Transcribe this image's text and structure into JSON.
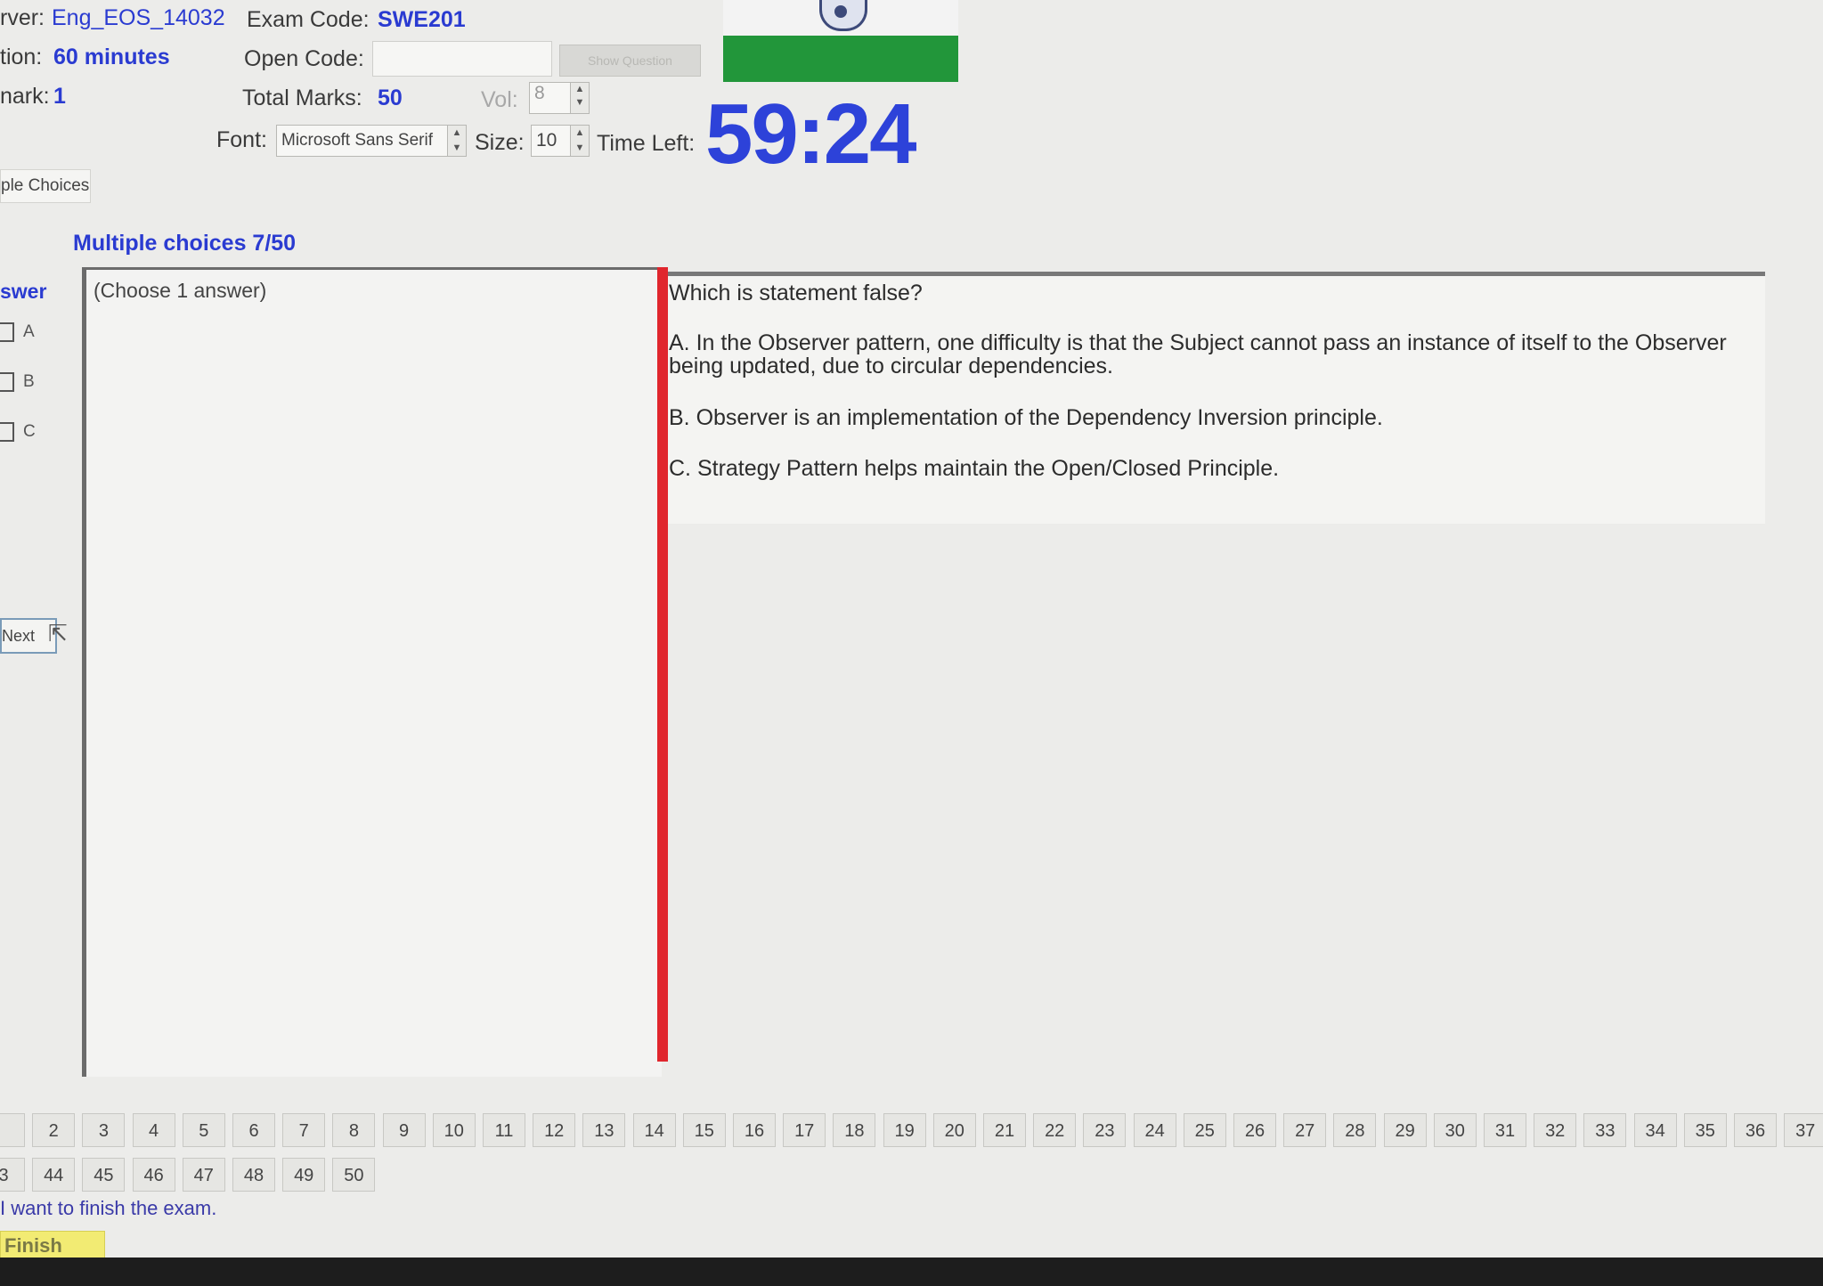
{
  "header": {
    "server_label": "rver:",
    "server_value": "Eng_EOS_14032",
    "exam_code_label": "Exam Code:",
    "exam_code_value": "SWE201",
    "duration_label": "tion:",
    "duration_value": "60 minutes",
    "open_code_label": "Open Code:",
    "open_code_value": "",
    "show_question_label": "Show Question",
    "mark_label": "nark:",
    "mark_value": "1",
    "total_marks_label": "Total Marks:",
    "total_marks_value": "50",
    "vol_label": "Vol:",
    "vol_value": "8",
    "font_label": "Font:",
    "font_value": "Microsoft Sans Serif",
    "size_label": "Size:",
    "size_value": "10",
    "time_left_label": "Time Left:",
    "time_left_value": "59:24"
  },
  "tab": {
    "label": "ple Choices"
  },
  "section_title": "Multiple choices 7/50",
  "answer_panel": {
    "heading": "swer",
    "options": [
      "A",
      "B",
      "C"
    ],
    "next_label": "Next"
  },
  "instruction": "(Choose 1 answer)",
  "question": {
    "text": "Which is statement false?",
    "options": [
      "A.  In the Observer pattern, one difficulty is that the Subject cannot pass an instance of itself to the Observer being updated, due to circular dependencies.",
      "B.  Observer is an implementation of the Dependency Inversion principle.",
      "C.  Strategy Pattern helps maintain the Open/Closed Principle."
    ]
  },
  "question_nav": {
    "row1": [
      "",
      "2",
      "3",
      "4",
      "5",
      "6",
      "7",
      "8",
      "9",
      "10",
      "11",
      "12",
      "13",
      "14",
      "15",
      "16",
      "17",
      "18",
      "19",
      "20",
      "21",
      "22",
      "23",
      "24",
      "25",
      "26",
      "27",
      "28",
      "29",
      "30",
      "31",
      "32",
      "33",
      "34",
      "35",
      "36",
      "37"
    ],
    "row2": [
      "3",
      "44",
      "45",
      "46",
      "47",
      "48",
      "49",
      "50"
    ]
  },
  "finish": {
    "confirm_text": "I want to finish the exam.",
    "button_label": "Finish"
  },
  "colors": {
    "accent_blue": "#2a3bd1",
    "timer_blue": "#2d42d9",
    "progress_green": "#22963a",
    "divider_red": "#e0262d",
    "finish_yellow": "#f2eb73"
  }
}
